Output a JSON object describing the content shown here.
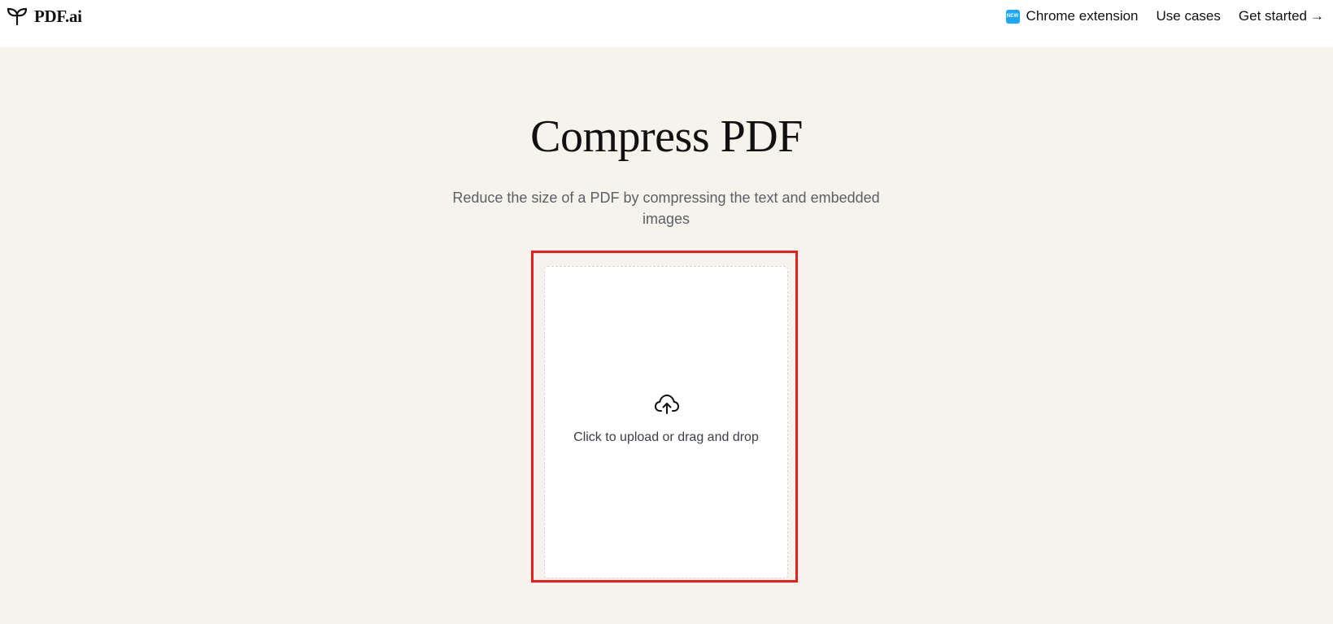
{
  "header": {
    "brand": "PDF.ai",
    "nav": {
      "chrome_badge": "NEW",
      "chrome_extension": "Chrome extension",
      "use_cases": "Use cases",
      "get_started": "Get started",
      "get_started_arrow": "→"
    }
  },
  "main": {
    "title": "Compress PDF",
    "subtitle": "Reduce the size of a PDF by compressing the text and embedded images",
    "dropzone": {
      "label": "Click to upload or drag and drop"
    }
  },
  "colors": {
    "page_background": "#f6f3ed",
    "header_background": "#ffffff",
    "badge_blue": "#1ea7ff",
    "highlight_red": "#ee1c1c"
  },
  "icons": {
    "brand": "sprout-icon",
    "upload": "cloud-upload-icon",
    "arrow": "arrow-right-icon"
  }
}
